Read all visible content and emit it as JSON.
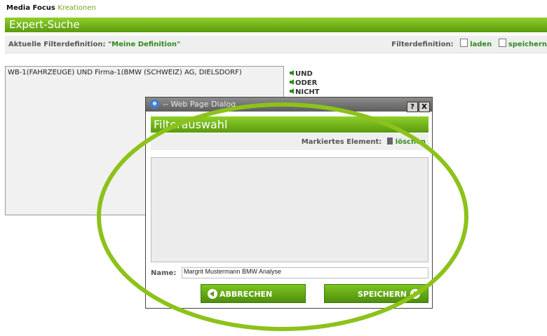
{
  "brand": {
    "name": "Media Focus",
    "subtitle": "Kreationen"
  },
  "page_title": "Expert-Suche",
  "filter_bar": {
    "current_label": "Aktuelle Filterdefinition:",
    "current_value": "\"Meine Definition\"",
    "definition_label": "Filterdefinition:",
    "load_label": "laden",
    "save_label": "speichern"
  },
  "query": {
    "text": "WB-1(FAHRZEUGE) UND Firma-1(BMW (SCHWEIZ) AG, DIELSDORF)"
  },
  "operators": [
    "UND",
    "ODER",
    "NICHT"
  ],
  "dialog": {
    "window_title": "-- Web Page Dialog",
    "help_button": "?",
    "close_button": "X",
    "header": "Filterauswahl",
    "marked_label": "Markiertes Element:",
    "delete_label": "löschen",
    "name_label": "Name:",
    "name_value": "Margrit Mustermann BMW Analyse",
    "cancel_label": "ABBRECHEN",
    "save_label": "SPEICHERN"
  },
  "colors": {
    "accent": "#6db21a",
    "link_green": "#2e8a1e",
    "highlight_ring": "#8cc21a"
  }
}
